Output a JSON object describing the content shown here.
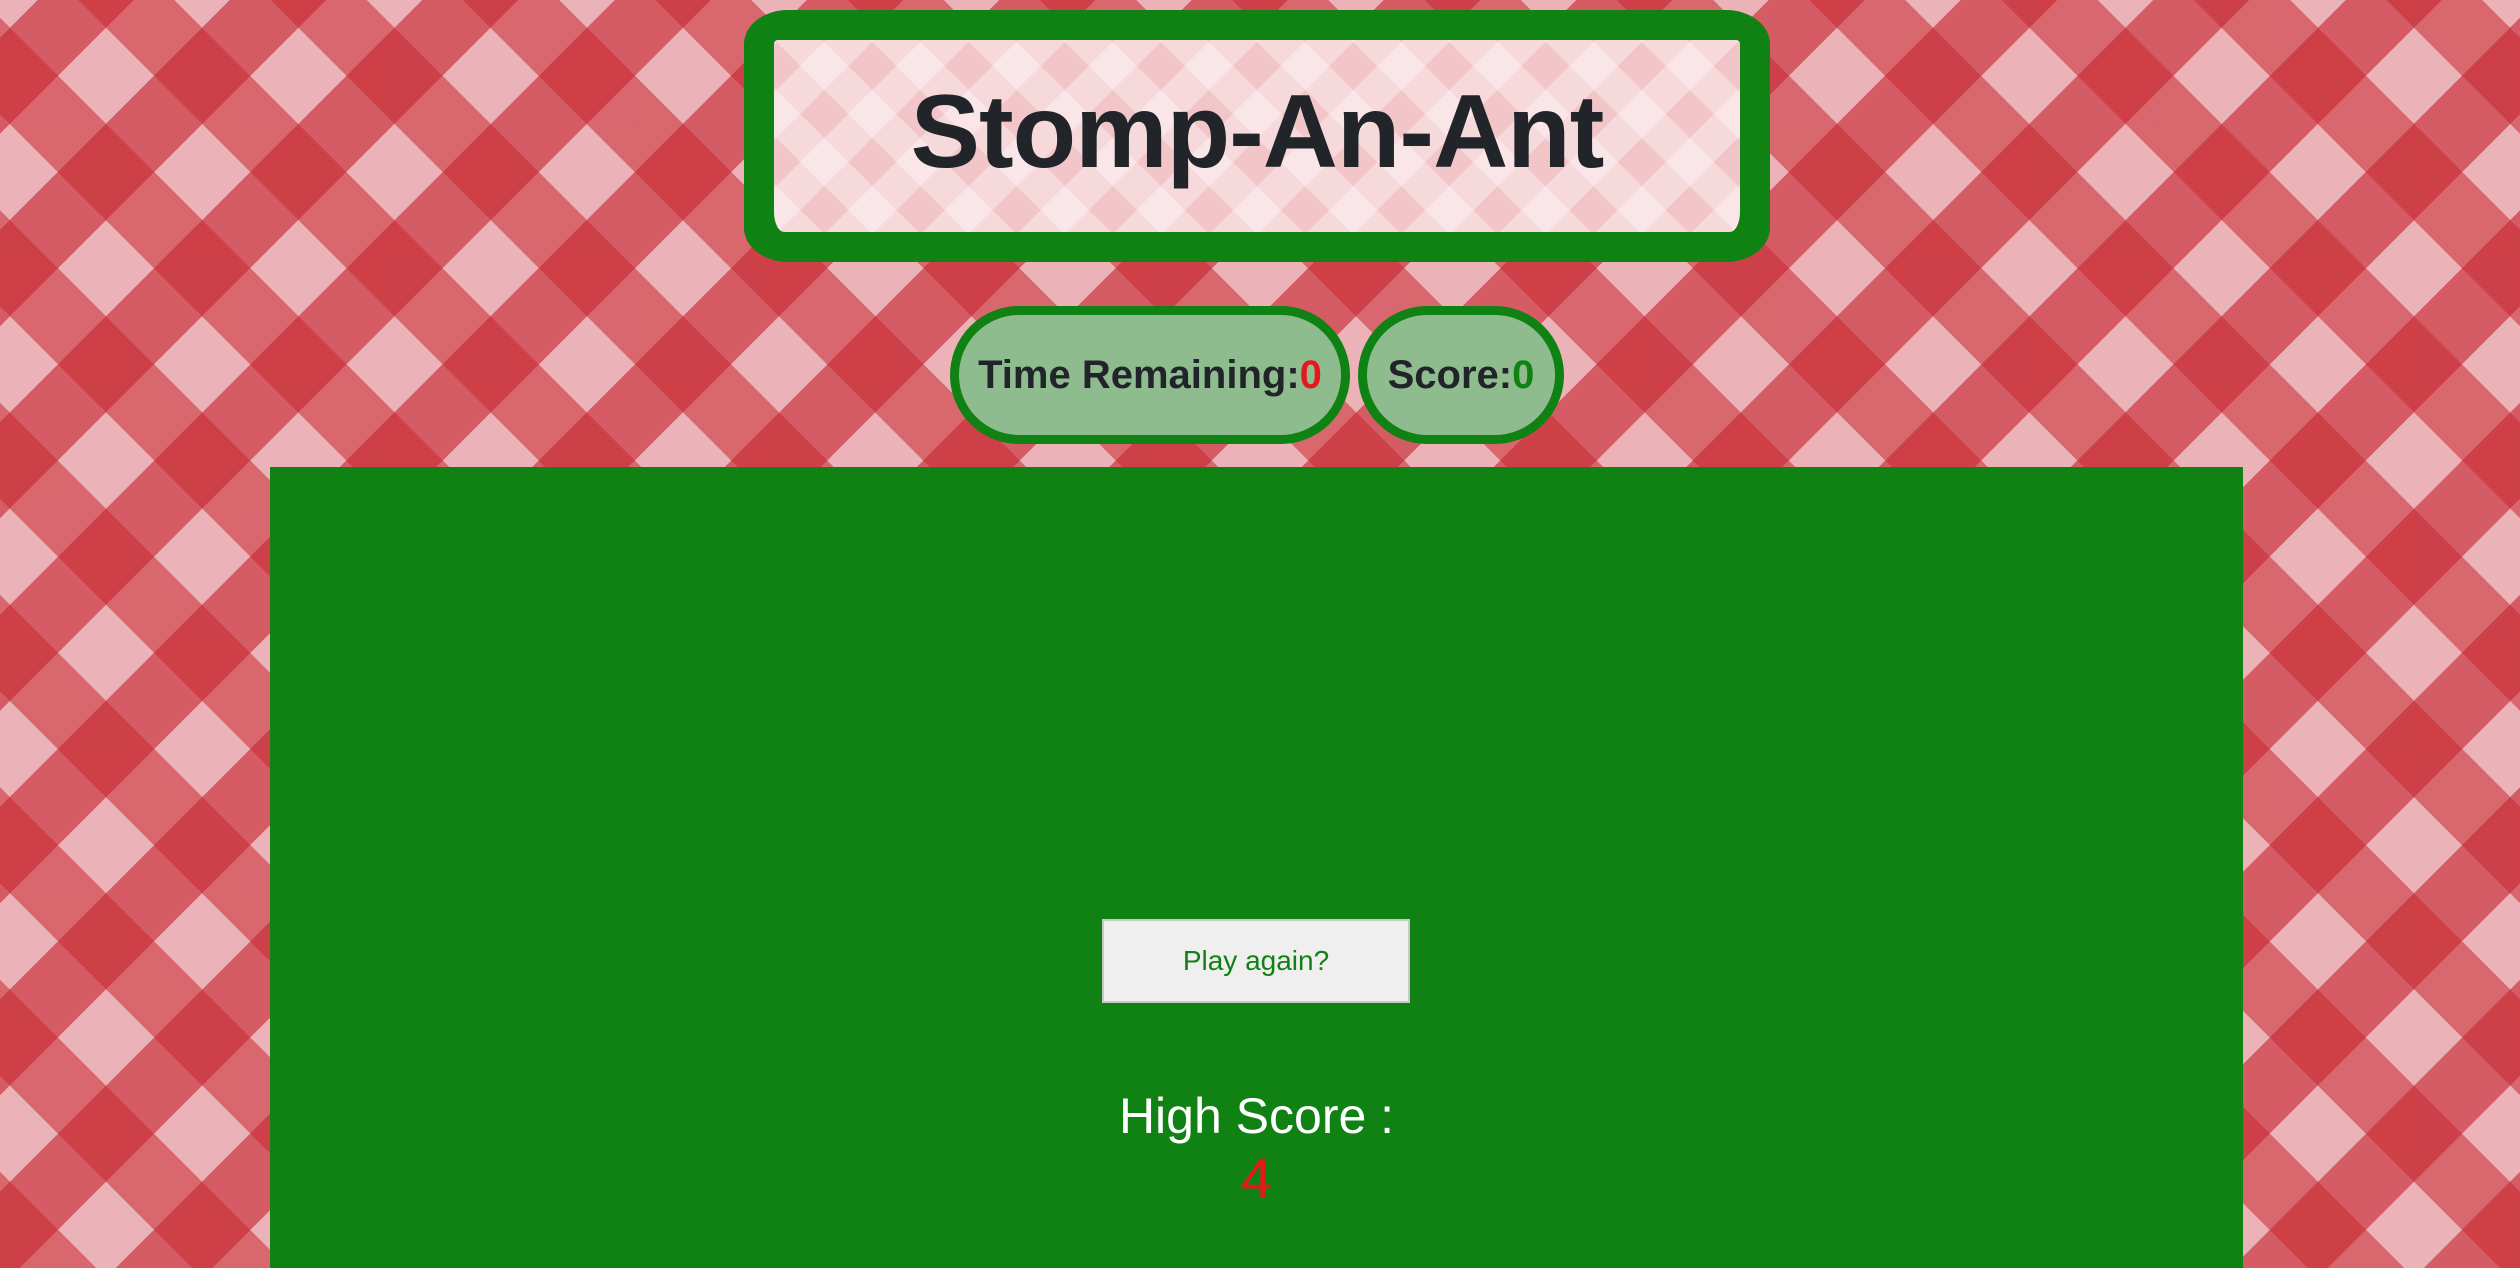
{
  "title": "Stomp-An-Ant",
  "stats": {
    "time_label": "Time Remaining:",
    "time_value": "0",
    "score_label": "Score:",
    "score_value": "0"
  },
  "board": {
    "play_again_label": "Play again?",
    "high_score_label": "High Score :",
    "high_score_value": "4"
  },
  "colors": {
    "board_green": "#108113",
    "accent_red": "#e3191e",
    "pill_fill": "#8fbc8f",
    "tablecloth_red": "#c8283a"
  }
}
